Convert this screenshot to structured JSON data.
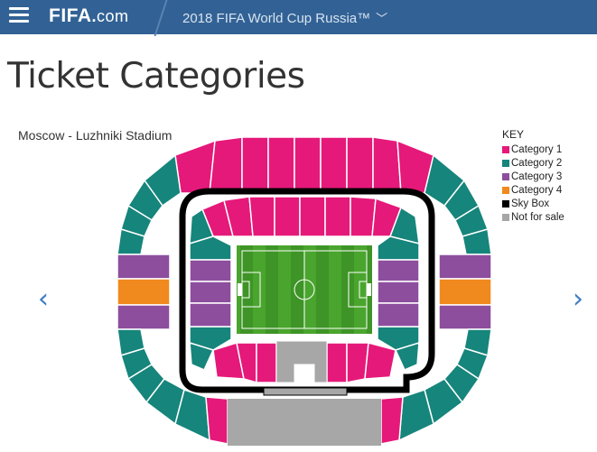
{
  "header": {
    "logo_fifa": "FIFA",
    "logo_dot": ".",
    "logo_com": "com",
    "tournament": "2018 FIFA World Cup Russia™",
    "tournament_chevron": "﹀"
  },
  "page": {
    "title": "Ticket Categories"
  },
  "stadium": {
    "city": "Moscow",
    "separator": " - ",
    "name": "Luzhniki Stadium"
  },
  "key": {
    "title": "KEY",
    "items": [
      {
        "label": "Category 1",
        "color": "#e5197a"
      },
      {
        "label": "Category 2",
        "color": "#16857b"
      },
      {
        "label": "Category 3",
        "color": "#8d4e9e"
      },
      {
        "label": "Category 4",
        "color": "#f08a1e"
      },
      {
        "label": "Sky Box",
        "color": "#000000"
      },
      {
        "label": "Not for sale",
        "color": "#a7a7a7"
      }
    ]
  },
  "nav": {
    "prev": "‹",
    "next": "›"
  },
  "icons": {
    "menu": "hamburger-icon",
    "prev": "chevron-left-icon",
    "next": "chevron-right-icon",
    "dropdown": "chevron-down-icon"
  }
}
